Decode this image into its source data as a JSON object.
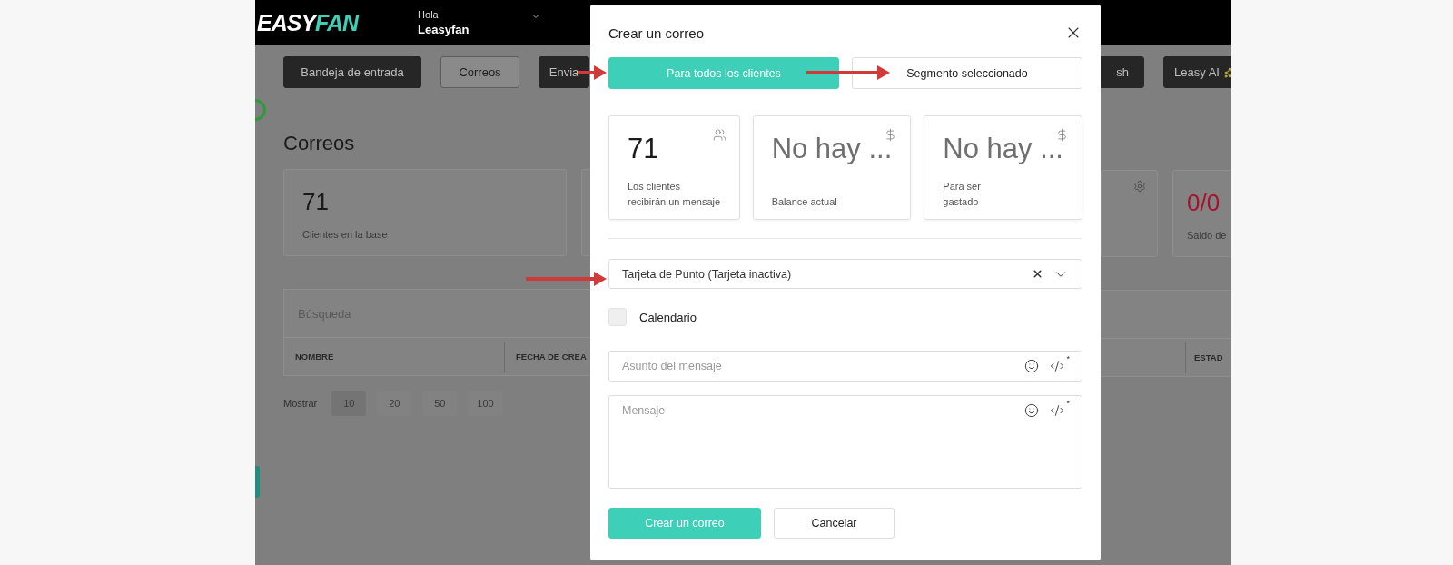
{
  "app": {
    "logo": {
      "part_1": "EASY",
      "part_2": "FAN"
    },
    "greeting": "Hola",
    "user": "Leasyfan",
    "nav_left": [
      {
        "label": "Bandeja de entrada",
        "selected": false
      },
      {
        "label": "Correos",
        "selected": true
      },
      {
        "label": "Envia",
        "selected": false
      }
    ],
    "nav_right": [
      {
        "label": "sh",
        "selected": false,
        "kind": "plain"
      },
      {
        "label": "Leasy AI",
        "selected": false,
        "kind": "sparkle"
      }
    ],
    "page_title": "Correos",
    "stat_left": {
      "value": "71",
      "label": "Clientes en la base"
    },
    "stat_right": {
      "value": "0/0",
      "label": "Saldo de"
    },
    "search": {
      "placeholder": "Búsqueda"
    },
    "columns_left": [
      "NOMBRE",
      "FECHA DE CREA"
    ],
    "columns_right": [
      "ESTAD"
    ],
    "page_size": {
      "label": "Mostrar",
      "options": [
        {
          "label": "10",
          "selected": true
        },
        {
          "label": "20",
          "selected": false
        },
        {
          "label": "50",
          "selected": false
        },
        {
          "label": "100",
          "selected": false
        }
      ]
    }
  },
  "modal": {
    "title": "Crear un correo",
    "audience_tabs": [
      {
        "label": "Para todos los clientes",
        "selected": true
      },
      {
        "label": "Segmento seleccionado",
        "selected": false
      }
    ],
    "stats": [
      {
        "value": "71",
        "label": "Los clientes recibirán un mensaje",
        "kind": "clients"
      },
      {
        "value": "No hay ...",
        "label": "\nBalance actual",
        "kind": "money"
      },
      {
        "value": "No hay ...",
        "label": "Para ser\ngastado",
        "kind": "money"
      }
    ],
    "card_select": {
      "value": "Tarjeta de Punto (Tarjeta inactiva)"
    },
    "schedule": {
      "label": "Calendario",
      "checked": false
    },
    "subject": {
      "placeholder": "Asunto del mensaje",
      "mark": "*"
    },
    "message": {
      "placeholder": "Mensaje",
      "mark": "*"
    },
    "buttons": [
      {
        "label": "Crear un correo",
        "kind": "primary"
      },
      {
        "label": "Cancelar",
        "kind": "secondary"
      }
    ]
  }
}
